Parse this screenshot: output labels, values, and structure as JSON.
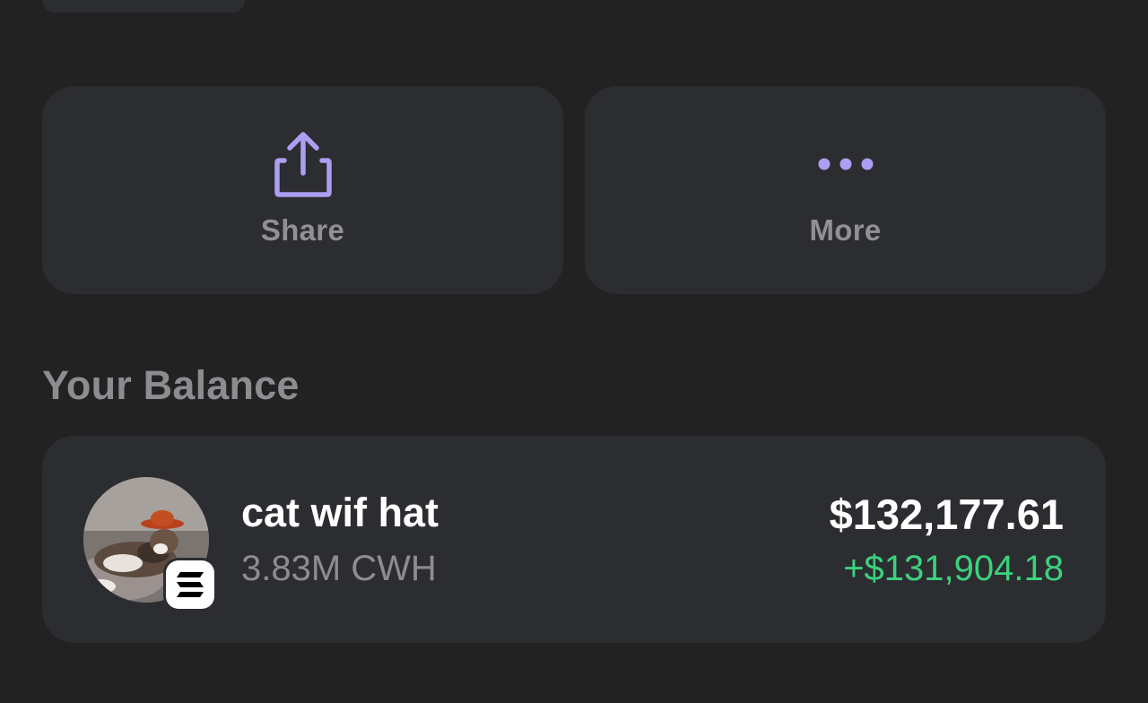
{
  "actions": {
    "share": {
      "label": "Share",
      "icon": "share-icon"
    },
    "more": {
      "label": "More",
      "icon": "more-dots-icon"
    }
  },
  "balance": {
    "title": "Your Balance",
    "token": {
      "name": "cat wif hat",
      "amount": "3.83M CWH",
      "value": "$132,177.61",
      "change": "+$131,904.18",
      "chain_icon": "solana-icon",
      "avatar": "token-avatar-image"
    }
  },
  "colors": {
    "background": "#222222",
    "card": "#2c2d31",
    "accent": "#ab9ff2",
    "muted_text": "#8c8c91",
    "positive": "#3cd27d"
  }
}
